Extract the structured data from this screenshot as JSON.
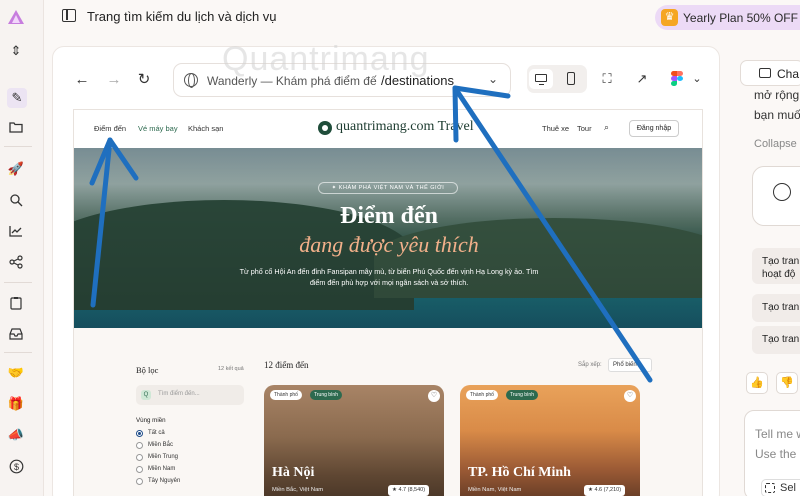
{
  "topbar": {
    "title": "Trang tìm kiếm du lịch và dịch vụ",
    "plan_badge": "Yearly Plan 50% OFF"
  },
  "rail": {
    "icons": [
      "app-logo",
      "chevron-updown",
      "edit",
      "folder",
      "rocket",
      "search-code",
      "chart",
      "share",
      "clipboard",
      "inbox",
      "handshake",
      "gift",
      "megaphone",
      "dollar"
    ]
  },
  "browser": {
    "address_site": "Wanderly — Khám phá điểm đế...",
    "address_path": "/destinations"
  },
  "site": {
    "nav": {
      "items": [
        "Điểm đến",
        "Vé máy bay",
        "Khách sạn"
      ],
      "logo": "quantrimang.com Travel",
      "right_items": [
        "Thuê xe",
        "Tour"
      ],
      "login": "Đăng nhập"
    },
    "hero": {
      "kicker": "✦ KHÁM PHÁ VIỆT NAM VÀ THẾ GIỚI",
      "title_line1": "Điểm đến",
      "title_line2": "đang được yêu thích",
      "subtitle": "Từ phố cổ Hội An đến đỉnh Fansipan mây mù, từ biển Phú Quốc đến vịnh Hạ Long kỳ ảo. Tìm điểm đến phù hợp với mọi ngân sách và sở thích."
    },
    "filters": {
      "title": "Bộ lọc",
      "count": "12 kết quả",
      "search_placeholder": "Tìm điểm đến...",
      "region_label": "Vùng miền",
      "regions": [
        "Tất cả",
        "Miền Bắc",
        "Miền Trung",
        "Miền Nam",
        "Tây Nguyên"
      ]
    },
    "results": {
      "title": "12 điểm đến",
      "sort_label": "Sắp xếp:",
      "sort_value": "Phổ biến"
    },
    "cards": [
      {
        "tag1": "Thành phố",
        "tag2": "Trung bình",
        "city": "Hà Nội",
        "location": "Miền Bắc, Việt Nam",
        "rating": "★ 4.7 (8,540)"
      },
      {
        "tag1": "Thành phố",
        "tag2": "Trung bình",
        "city": "TP. Hồ Chí Minh",
        "location": "Miền Nam, Việt Nam",
        "rating": "★ 4.6 (7,210)"
      }
    ]
  },
  "right_panel": {
    "tab": "Cha",
    "text1": "mở rộng",
    "text2": "bạn muố",
    "collapse": "Collapse",
    "chip1_line1": "Tạo tran",
    "chip1_line2": "hoạt độ",
    "chip2": "Tạo tran",
    "chip3": "Tạo tran",
    "input_line1": "Tell me w",
    "input_line2": "Use the",
    "select_label": "Sel"
  },
  "watermark": "Quantrimang"
}
